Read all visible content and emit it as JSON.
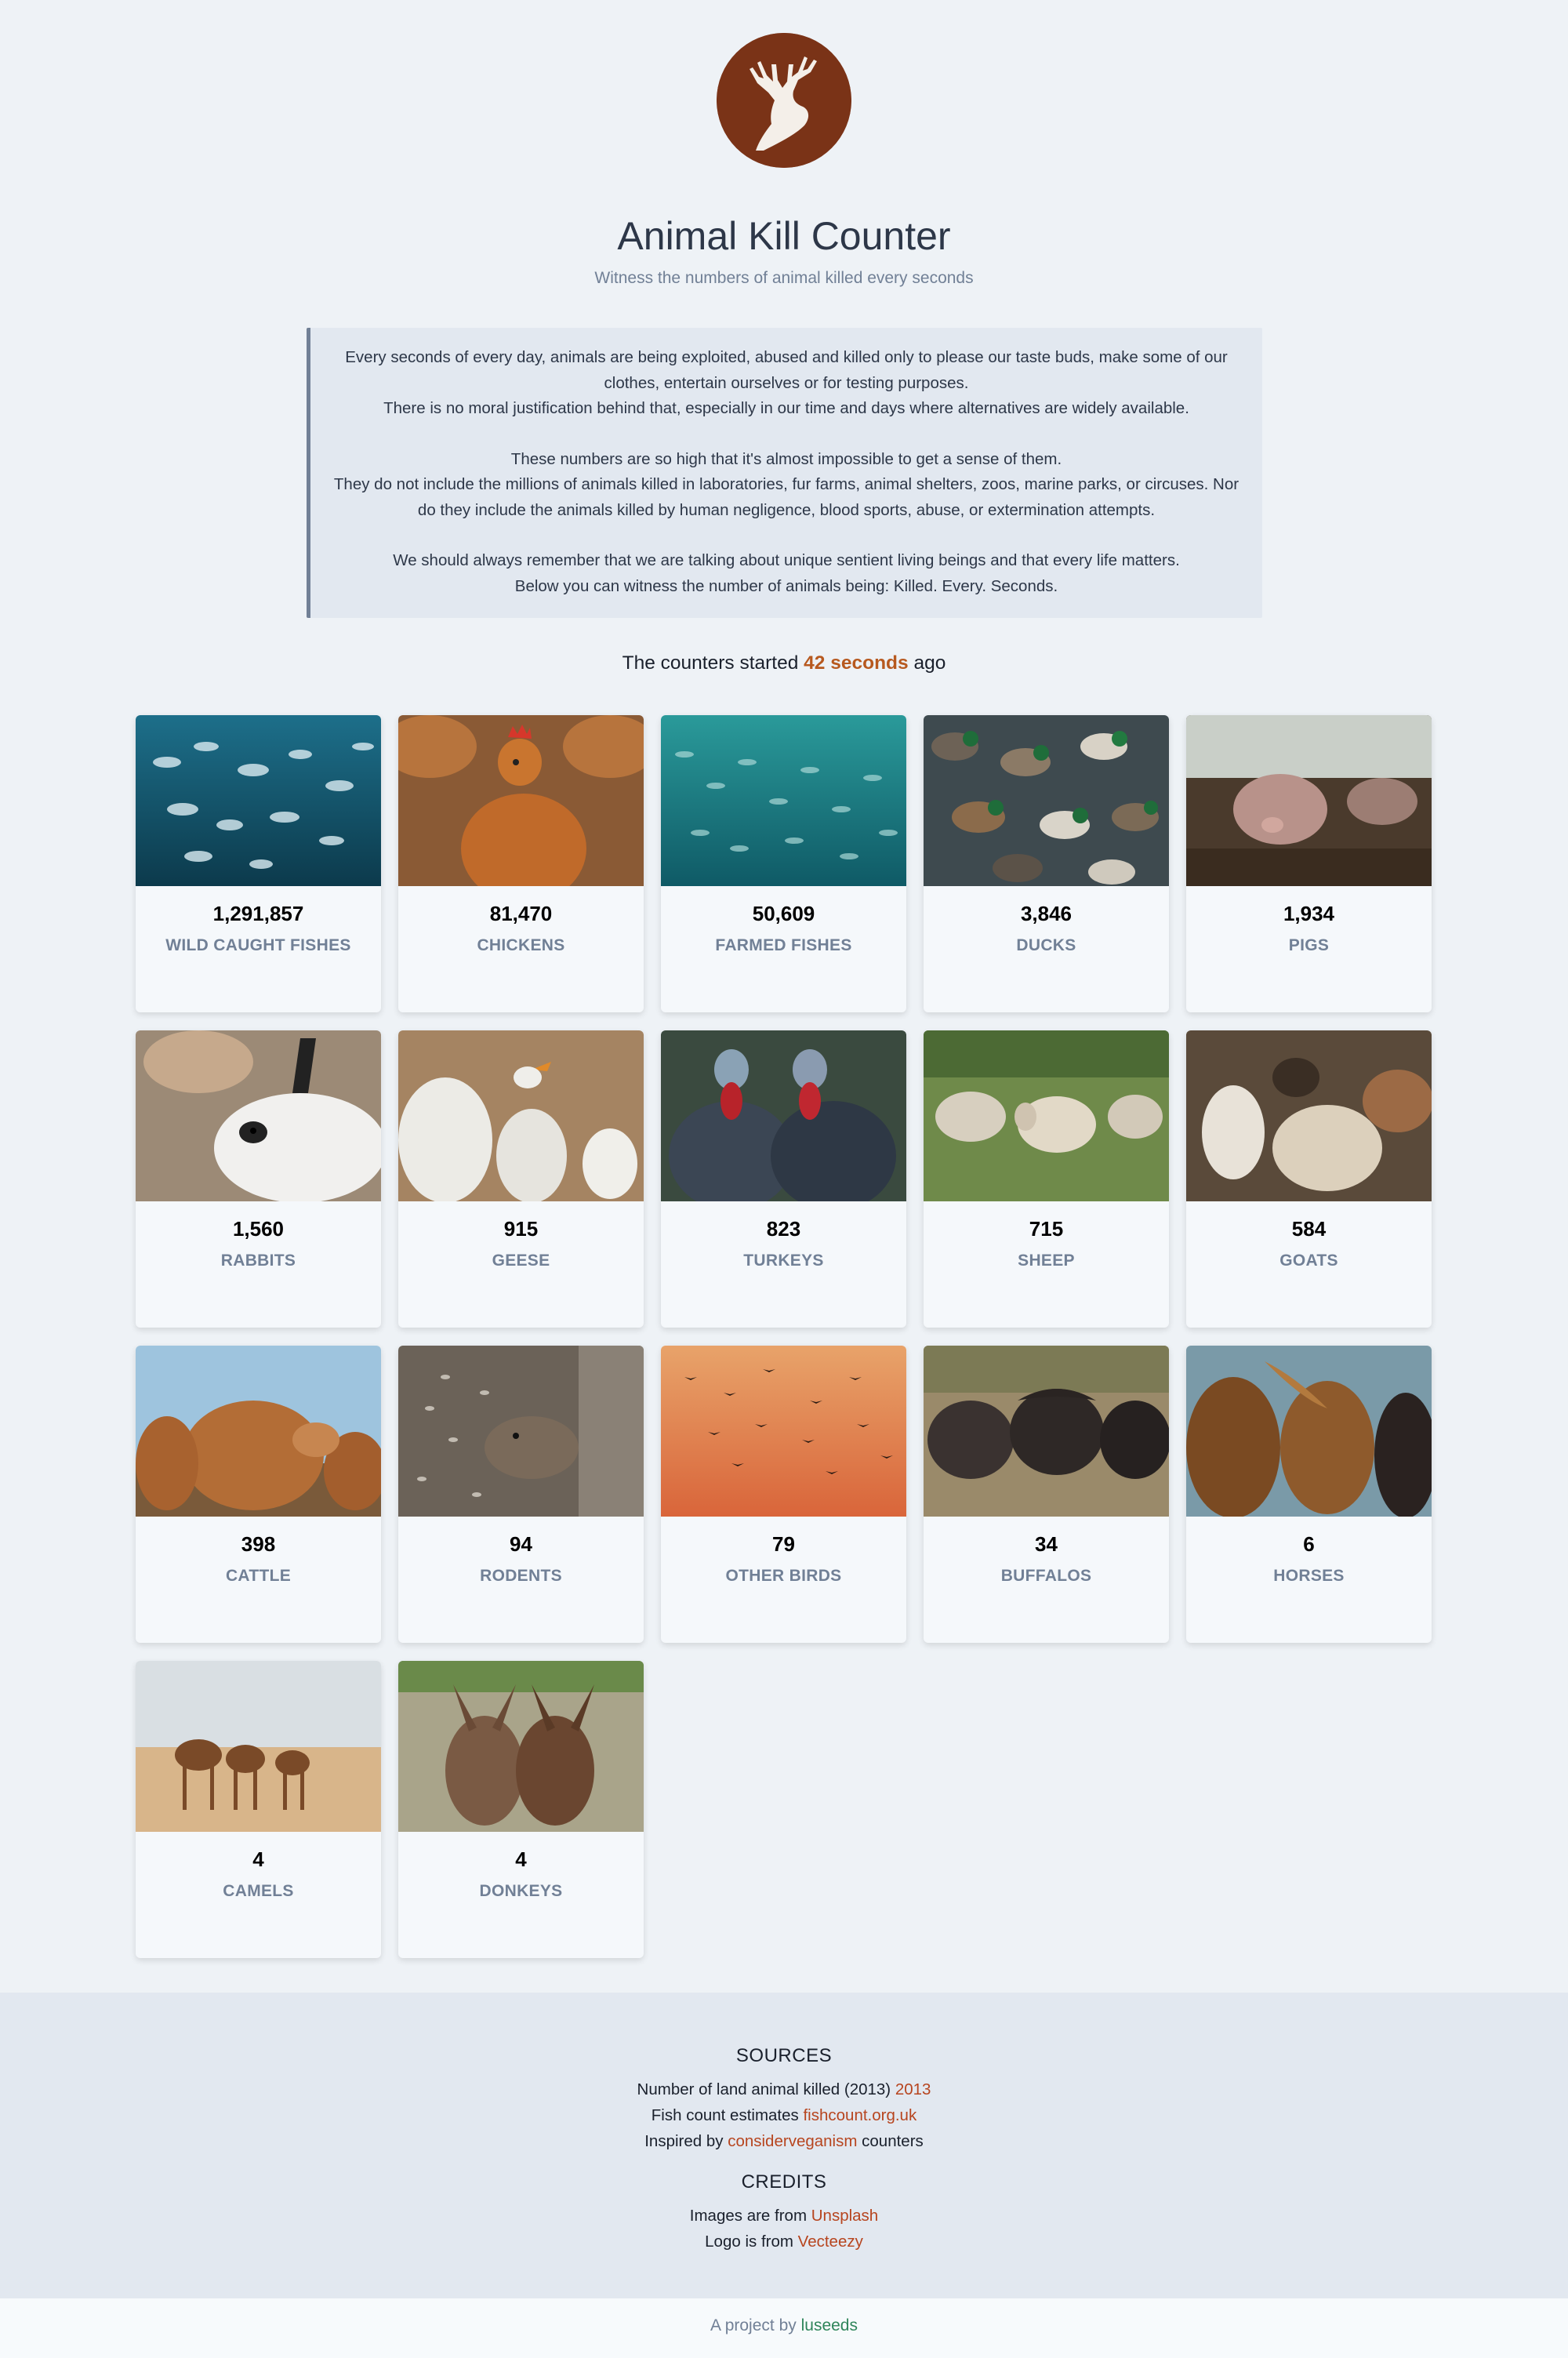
{
  "header": {
    "title": "Animal Kill Counter",
    "subtitle": "Witness the numbers of animal killed every seconds",
    "logo_icon": "deer-head-logo-icon"
  },
  "intro": {
    "p1": "Every seconds of every day, animals are being exploited, abused and killed only to please our taste buds, make some of our clothes, entertain ourselves or for testing purposes.",
    "p2": "There is no moral justification behind that, especially in our time and days where alternatives are widely available.",
    "p3": "These numbers are so high that it's almost impossible to get a sense of them.",
    "p4": "They do not include the millions of animals killed in laboratories, fur farms, animal shelters, zoos, marine parks, or circuses. Nor do they include the animals killed by human negligence, blood sports, abuse, or extermination attempts.",
    "p5": "We should always remember that we are talking about unique sentient living beings and that every life matters.",
    "p6": "Below you can witness the number of animals being: Killed. Every. Seconds."
  },
  "counter": {
    "prefix": "The counters started",
    "value": "42 seconds",
    "suffix": "ago"
  },
  "cards": [
    {
      "count": "1,291,857",
      "label": "WILD CAUGHT FISHES"
    },
    {
      "count": "81,470",
      "label": "CHICKENS"
    },
    {
      "count": "50,609",
      "label": "FARMED FISHES"
    },
    {
      "count": "3,846",
      "label": "DUCKS"
    },
    {
      "count": "1,934",
      "label": "PIGS"
    },
    {
      "count": "1,560",
      "label": "RABBITS"
    },
    {
      "count": "915",
      "label": "GEESE"
    },
    {
      "count": "823",
      "label": "TURKEYS"
    },
    {
      "count": "715",
      "label": "SHEEP"
    },
    {
      "count": "584",
      "label": "GOATS"
    },
    {
      "count": "398",
      "label": "CATTLE"
    },
    {
      "count": "94",
      "label": "RODENTS"
    },
    {
      "count": "79",
      "label": "OTHER BIRDS"
    },
    {
      "count": "34",
      "label": "BUFFALOS"
    },
    {
      "count": "6",
      "label": "HORSES"
    },
    {
      "count": "4",
      "label": "CAMELS"
    },
    {
      "count": "4",
      "label": "DONKEYS"
    }
  ],
  "footer": {
    "sources_title": "SOURCES",
    "src1_text": "Number of land animal killed (2013)",
    "src1_link": "2013",
    "src2_text": "Fish count estimates",
    "src2_link": "fishcount.org.uk",
    "src3_prefix": "Inspired by",
    "src3_link": "considerveganism",
    "src3_suffix": "counters",
    "credits_title": "CREDITS",
    "cr1_text": "Images are from",
    "cr1_link": "Unsplash",
    "cr2_text": "Logo is from",
    "cr2_link": "Vecteezy"
  },
  "bottom": {
    "text": "A project by",
    "link": "luseeds"
  },
  "colors": {
    "accent": "#b7591f",
    "logo_bg": "#7a3317",
    "link": "#b7451f",
    "author_link": "#2f855a"
  }
}
